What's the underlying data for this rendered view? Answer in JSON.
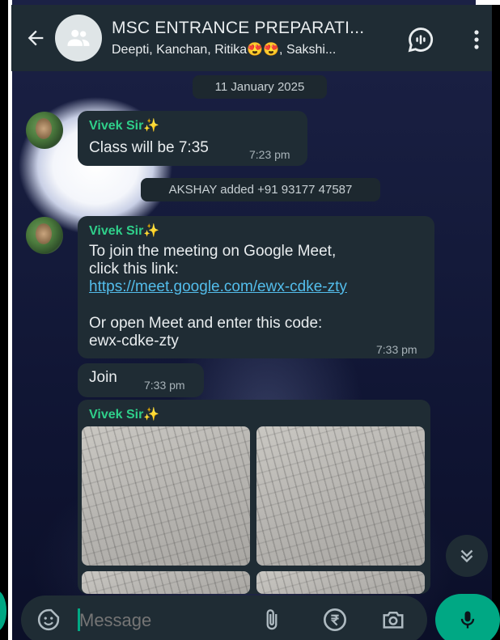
{
  "header": {
    "title": "MSC ENTRANCE PREPARATI...",
    "subtitle": "Deepti, Kanchan, Ritika😍😍, Sakshi..."
  },
  "date_chip": "11 January 2025",
  "system_chip": "AKSHAY added +91 93177 47587",
  "messages": [
    {
      "sender": "Vivek Sir✨",
      "text": "Class will be 7:35",
      "time": "7:23 pm"
    },
    {
      "sender": "Vivek Sir✨",
      "line1": "To join the meeting on Google Meet,",
      "line2": "click this link:",
      "link": "https://meet.google.com/ewx-cdke-zty",
      "line3": "Or open Meet and enter this code:",
      "line4": "ewx-cdke-zty",
      "time": "7:33 pm"
    },
    {
      "text": "Join",
      "time": "7:33 pm"
    },
    {
      "sender": "Vivek Sir✨"
    }
  ],
  "input": {
    "placeholder": "Message"
  },
  "colors": {
    "header_bg": "#1f2c34",
    "bubble_bg": "#1f2c34",
    "sender_name": "#2fcf8a",
    "link": "#53bdeb",
    "accent": "#00a884"
  },
  "icons": {
    "back": "arrow-left-icon",
    "group": "group-avatar-icon",
    "call": "voice-call-icon",
    "menu": "more-vertical-icon",
    "sticker": "sticker-icon",
    "attach": "paperclip-icon",
    "payment": "rupee-icon",
    "camera": "camera-icon",
    "mic": "mic-icon",
    "scroll": "double-chevron-down-icon"
  }
}
